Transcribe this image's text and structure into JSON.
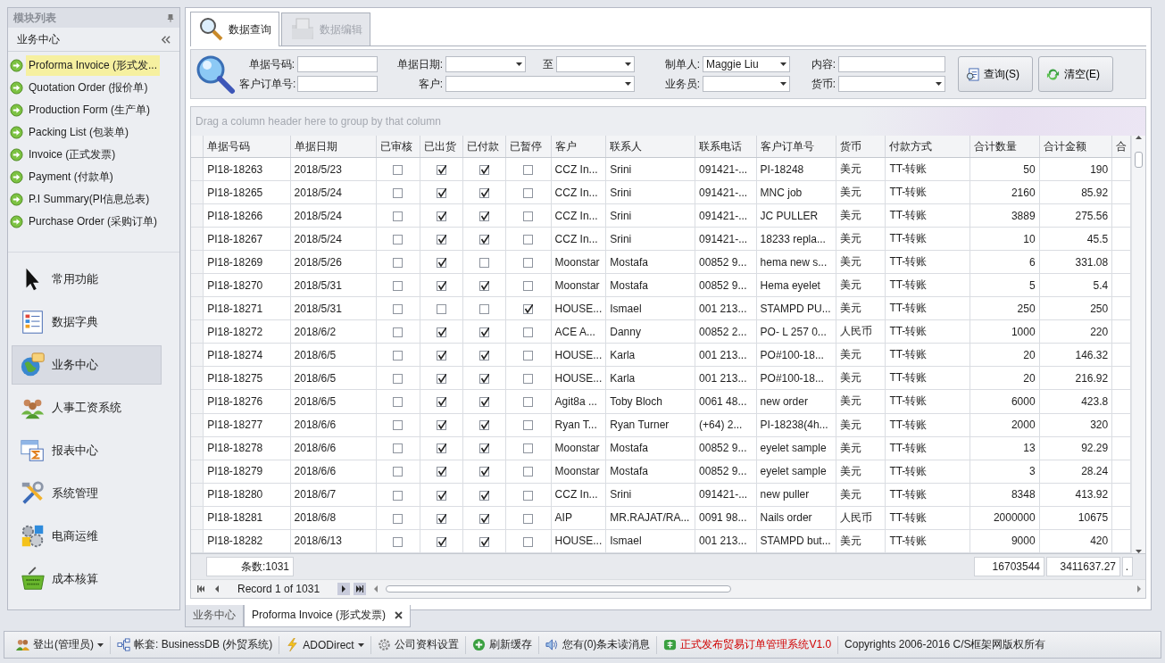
{
  "sidebar": {
    "title": "模块列表",
    "section": "业务中心",
    "items": [
      {
        "label": "Proforma Invoice (形式发...",
        "selected": true
      },
      {
        "label": "Quotation Order (报价单)",
        "selected": false
      },
      {
        "label": "Production Form (生产单)",
        "selected": false
      },
      {
        "label": "Packing List (包装单)",
        "selected": false
      },
      {
        "label": "Invoice (正式发票)",
        "selected": false
      },
      {
        "label": "Payment (付款单)",
        "selected": false
      },
      {
        "label": "P.I Summary(PI信息总表)",
        "selected": false
      },
      {
        "label": "Purchase Order (采购订单)",
        "selected": false
      }
    ],
    "groups": [
      {
        "label": "常用功能",
        "selected": false
      },
      {
        "label": "数据字典",
        "selected": false
      },
      {
        "label": "业务中心",
        "selected": true
      },
      {
        "label": "人事工资系统",
        "selected": false
      },
      {
        "label": "报表中心",
        "selected": false
      },
      {
        "label": "系统管理",
        "selected": false
      },
      {
        "label": "电商运维",
        "selected": false
      },
      {
        "label": "成本核算",
        "selected": false
      }
    ]
  },
  "tabs": [
    {
      "label": "数据查询",
      "selected": true,
      "disabled": false
    },
    {
      "label": "数据编辑",
      "selected": false,
      "disabled": true
    }
  ],
  "filters": [
    {
      "label": "单据号码:",
      "kind": "text"
    },
    {
      "label": "单据日期:",
      "kind": "dropdown"
    },
    {
      "label": "至",
      "kind": "dropdown"
    },
    {
      "label": "制单人:",
      "kind": "dropdown",
      "value": "Maggie Liu"
    },
    {
      "label": "内容:",
      "kind": "text"
    },
    {
      "label": "客户订单号:",
      "kind": "text"
    },
    {
      "label": "客户:",
      "kind": "longdropdown"
    },
    {
      "label": "业务员:",
      "kind": "dropdown"
    },
    {
      "label": "货币:",
      "kind": "dropdown"
    }
  ],
  "buttons": [
    {
      "label": "查询(S)",
      "kind": "search"
    },
    {
      "label": "清空(E)",
      "kind": "clear"
    }
  ],
  "grid": {
    "group_hint": "Drag a column header here to group by that column",
    "columns": [
      {
        "label": "单据号码",
        "kind": "text"
      },
      {
        "label": "单据日期",
        "kind": "text"
      },
      {
        "label": "已审核",
        "kind": "check"
      },
      {
        "label": "已出货",
        "kind": "check"
      },
      {
        "label": "已付款",
        "kind": "check"
      },
      {
        "label": "已暂停",
        "kind": "check"
      },
      {
        "label": "客户",
        "kind": "text"
      },
      {
        "label": "联系人",
        "kind": "text"
      },
      {
        "label": "联系电话",
        "kind": "text"
      },
      {
        "label": "客户订单号",
        "kind": "text"
      },
      {
        "label": "货币",
        "kind": "text"
      },
      {
        "label": "付款方式",
        "kind": "text"
      },
      {
        "label": "合计数量",
        "kind": "number"
      },
      {
        "label": "合计金额",
        "kind": "number"
      },
      {
        "label": "合",
        "kind": "empty"
      }
    ],
    "rows": [
      {
        "cells": [
          {
            "text": "PI18-18263"
          },
          {
            "text": "2018/5/23"
          },
          {
            "checked": false
          },
          {
            "checked": true
          },
          {
            "checked": true
          },
          {
            "checked": false
          },
          {
            "text": "CCZ In..."
          },
          {
            "text": "Srini"
          },
          {
            "text": "091421-..."
          },
          {
            "text": "PI-18248"
          },
          {
            "text": "美元"
          },
          {
            "text": "TT-转账"
          },
          {
            "text": "50"
          },
          {
            "text": "190"
          }
        ]
      },
      {
        "cells": [
          {
            "text": "PI18-18265"
          },
          {
            "text": "2018/5/24"
          },
          {
            "checked": false
          },
          {
            "checked": true
          },
          {
            "checked": true
          },
          {
            "checked": false
          },
          {
            "text": "CCZ In..."
          },
          {
            "text": "Srini"
          },
          {
            "text": "091421-..."
          },
          {
            "text": "MNC job"
          },
          {
            "text": "美元"
          },
          {
            "text": "TT-转账"
          },
          {
            "text": "2160"
          },
          {
            "text": "85.92"
          }
        ]
      },
      {
        "cells": [
          {
            "text": "PI18-18266"
          },
          {
            "text": "2018/5/24"
          },
          {
            "checked": false
          },
          {
            "checked": true
          },
          {
            "checked": true
          },
          {
            "checked": false
          },
          {
            "text": "CCZ In..."
          },
          {
            "text": "Srini"
          },
          {
            "text": "091421-..."
          },
          {
            "text": "JC PULLER"
          },
          {
            "text": "美元"
          },
          {
            "text": "TT-转账"
          },
          {
            "text": "3889"
          },
          {
            "text": "275.56"
          }
        ]
      },
      {
        "cells": [
          {
            "text": "PI18-18267"
          },
          {
            "text": "2018/5/24"
          },
          {
            "checked": false
          },
          {
            "checked": true
          },
          {
            "checked": true
          },
          {
            "checked": false
          },
          {
            "text": "CCZ In..."
          },
          {
            "text": "Srini"
          },
          {
            "text": "091421-..."
          },
          {
            "text": "18233 repla..."
          },
          {
            "text": "美元"
          },
          {
            "text": "TT-转账"
          },
          {
            "text": "10"
          },
          {
            "text": "45.5"
          }
        ]
      },
      {
        "cells": [
          {
            "text": "PI18-18269"
          },
          {
            "text": "2018/5/26"
          },
          {
            "checked": false
          },
          {
            "checked": true
          },
          {
            "checked": false
          },
          {
            "checked": false
          },
          {
            "text": "Moonstar"
          },
          {
            "text": "Mostafa"
          },
          {
            "text": "00852 9..."
          },
          {
            "text": "hema new s..."
          },
          {
            "text": "美元"
          },
          {
            "text": "TT-转账"
          },
          {
            "text": "6"
          },
          {
            "text": "331.08"
          }
        ]
      },
      {
        "cells": [
          {
            "text": "PI18-18270"
          },
          {
            "text": "2018/5/31"
          },
          {
            "checked": false
          },
          {
            "checked": true
          },
          {
            "checked": true
          },
          {
            "checked": false
          },
          {
            "text": "Moonstar"
          },
          {
            "text": "Mostafa"
          },
          {
            "text": "00852 9..."
          },
          {
            "text": "Hema eyelet"
          },
          {
            "text": "美元"
          },
          {
            "text": "TT-转账"
          },
          {
            "text": "5"
          },
          {
            "text": "5.4"
          }
        ]
      },
      {
        "cells": [
          {
            "text": "PI18-18271"
          },
          {
            "text": "2018/5/31"
          },
          {
            "checked": false
          },
          {
            "checked": false
          },
          {
            "checked": false
          },
          {
            "checked": true
          },
          {
            "text": "HOUSE..."
          },
          {
            "text": "Ismael"
          },
          {
            "text": "001 213..."
          },
          {
            "text": "STAMPD PU..."
          },
          {
            "text": "美元"
          },
          {
            "text": "TT-转账"
          },
          {
            "text": "250"
          },
          {
            "text": "250"
          }
        ]
      },
      {
        "cells": [
          {
            "text": "PI18-18272"
          },
          {
            "text": "2018/6/2"
          },
          {
            "checked": false
          },
          {
            "checked": true
          },
          {
            "checked": true
          },
          {
            "checked": false
          },
          {
            "text": "ACE A..."
          },
          {
            "text": "Danny"
          },
          {
            "text": "00852 2..."
          },
          {
            "text": "PO- L 257 0..."
          },
          {
            "text": "人民币"
          },
          {
            "text": "TT-转账"
          },
          {
            "text": "1000"
          },
          {
            "text": "220"
          }
        ]
      },
      {
        "cells": [
          {
            "text": "PI18-18274"
          },
          {
            "text": "2018/6/5"
          },
          {
            "checked": false
          },
          {
            "checked": true
          },
          {
            "checked": true
          },
          {
            "checked": false
          },
          {
            "text": "HOUSE..."
          },
          {
            "text": "Karla"
          },
          {
            "text": "001 213..."
          },
          {
            "text": "PO#100-18..."
          },
          {
            "text": "美元"
          },
          {
            "text": "TT-转账"
          },
          {
            "text": "20"
          },
          {
            "text": "146.32"
          }
        ]
      },
      {
        "cells": [
          {
            "text": "PI18-18275"
          },
          {
            "text": "2018/6/5"
          },
          {
            "checked": false
          },
          {
            "checked": true
          },
          {
            "checked": true
          },
          {
            "checked": false
          },
          {
            "text": "HOUSE..."
          },
          {
            "text": "Karla"
          },
          {
            "text": "001 213..."
          },
          {
            "text": "PO#100-18..."
          },
          {
            "text": "美元"
          },
          {
            "text": "TT-转账"
          },
          {
            "text": "20"
          },
          {
            "text": "216.92"
          }
        ]
      },
      {
        "cells": [
          {
            "text": "PI18-18276"
          },
          {
            "text": "2018/6/5"
          },
          {
            "checked": false
          },
          {
            "checked": true
          },
          {
            "checked": true
          },
          {
            "checked": false
          },
          {
            "text": "Agit8a ..."
          },
          {
            "text": "Toby Bloch"
          },
          {
            "text": "0061 48..."
          },
          {
            "text": "new order"
          },
          {
            "text": "美元"
          },
          {
            "text": "TT-转账"
          },
          {
            "text": "6000"
          },
          {
            "text": "423.8"
          }
        ]
      },
      {
        "cells": [
          {
            "text": "PI18-18277"
          },
          {
            "text": "2018/6/6"
          },
          {
            "checked": false
          },
          {
            "checked": true
          },
          {
            "checked": true
          },
          {
            "checked": false
          },
          {
            "text": "Ryan T..."
          },
          {
            "text": "Ryan Turner"
          },
          {
            "text": "(+64) 2..."
          },
          {
            "text": "PI-18238(4h..."
          },
          {
            "text": "美元"
          },
          {
            "text": "TT-转账"
          },
          {
            "text": "2000"
          },
          {
            "text": "320"
          }
        ]
      },
      {
        "cells": [
          {
            "text": "PI18-18278"
          },
          {
            "text": "2018/6/6"
          },
          {
            "checked": false
          },
          {
            "checked": true
          },
          {
            "checked": true
          },
          {
            "checked": false
          },
          {
            "text": "Moonstar"
          },
          {
            "text": "Mostafa"
          },
          {
            "text": "00852 9..."
          },
          {
            "text": "eyelet sample"
          },
          {
            "text": "美元"
          },
          {
            "text": "TT-转账"
          },
          {
            "text": "13"
          },
          {
            "text": "92.29"
          }
        ]
      },
      {
        "cells": [
          {
            "text": "PI18-18279"
          },
          {
            "text": "2018/6/6"
          },
          {
            "checked": false
          },
          {
            "checked": true
          },
          {
            "checked": true
          },
          {
            "checked": false
          },
          {
            "text": "Moonstar"
          },
          {
            "text": "Mostafa"
          },
          {
            "text": "00852 9..."
          },
          {
            "text": "eyelet sample"
          },
          {
            "text": "美元"
          },
          {
            "text": "TT-转账"
          },
          {
            "text": "3"
          },
          {
            "text": "28.24"
          }
        ]
      },
      {
        "cells": [
          {
            "text": "PI18-18280"
          },
          {
            "text": "2018/6/7"
          },
          {
            "checked": false
          },
          {
            "checked": true
          },
          {
            "checked": true
          },
          {
            "checked": false
          },
          {
            "text": "CCZ In..."
          },
          {
            "text": "Srini"
          },
          {
            "text": "091421-..."
          },
          {
            "text": "new puller"
          },
          {
            "text": "美元"
          },
          {
            "text": "TT-转账"
          },
          {
            "text": "8348"
          },
          {
            "text": "413.92"
          }
        ]
      },
      {
        "cells": [
          {
            "text": "PI18-18281"
          },
          {
            "text": "2018/6/8"
          },
          {
            "checked": false
          },
          {
            "checked": true
          },
          {
            "checked": true
          },
          {
            "checked": false
          },
          {
            "text": "AIP"
          },
          {
            "text": "MR.RAJAT/RA..."
          },
          {
            "text": "0091 98..."
          },
          {
            "text": "Nails order"
          },
          {
            "text": "人民币"
          },
          {
            "text": "TT-转账"
          },
          {
            "text": "2000000"
          },
          {
            "text": "10675"
          }
        ]
      },
      {
        "cells": [
          {
            "text": "PI18-18282"
          },
          {
            "text": "2018/6/13"
          },
          {
            "checked": false
          },
          {
            "checked": true
          },
          {
            "checked": true
          },
          {
            "checked": false
          },
          {
            "text": "HOUSE..."
          },
          {
            "text": "Ismael"
          },
          {
            "text": "001 213..."
          },
          {
            "text": "STAMPD but..."
          },
          {
            "text": "美元"
          },
          {
            "text": "TT-转账"
          },
          {
            "text": "9000"
          },
          {
            "text": "420"
          }
        ]
      }
    ],
    "footer": {
      "count": "条数:1031",
      "qty_total": "16703544",
      "amount_total": "3411637.27",
      "column_16": "."
    },
    "navigator": {
      "record": "Record 1 of 1031"
    }
  },
  "doc_tabs": [
    {
      "label": "业务中心",
      "selected": false,
      "closable": false
    },
    {
      "label": "Proforma Invoice (形式发票)",
      "selected": true,
      "closable": true
    }
  ],
  "status_bar": [
    {
      "label": "登出(管理员)",
      "kind": "menu"
    },
    {
      "label": "帐套: BusinessDB (外贸系统)",
      "kind": "db"
    },
    {
      "label": "ADODirect",
      "kind": "bolt-menu"
    },
    {
      "label": "公司资料设置",
      "kind": "gear"
    },
    {
      "label": "刷新缓存",
      "kind": "refresh"
    },
    {
      "label": "您有(0)条未读消息",
      "kind": "speaker"
    },
    {
      "label": "正式发布贸易订单管理系统V1.0",
      "kind": "new"
    },
    {
      "label": "Copyrights 2006-2016 C/S框架网版权所有",
      "kind": "text"
    }
  ]
}
